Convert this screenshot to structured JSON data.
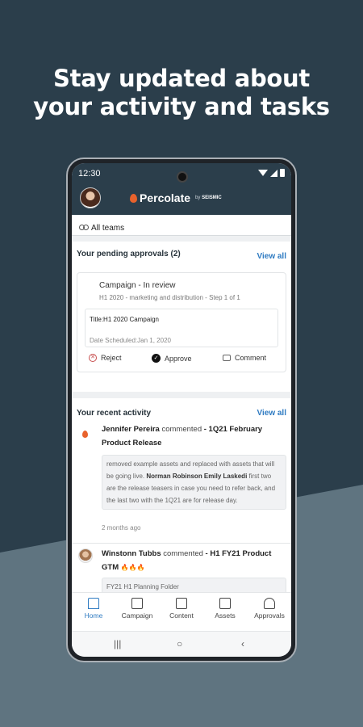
{
  "headline": {
    "line1": "Stay updated about",
    "line2": "your activity and tasks"
  },
  "status_bar": {
    "time": "12:30"
  },
  "app": {
    "logo_text": "Percolate",
    "logo_by": "by",
    "logo_brand": "SEISMIC"
  },
  "filter": {
    "label": "All teams"
  },
  "approvals": {
    "title": "Your pending approvals (2)",
    "view_all": "View all",
    "item": {
      "title": "Campaign - In review",
      "subtitle": "H1 2020 - marketing and distribution  - Step 1 of 1",
      "detail_title": "Title:H1 2020 Campaign",
      "detail_date": "Date Scheduled:Jan 1, 2020"
    },
    "actions": {
      "reject": "Reject",
      "approve": "Approve",
      "comment": "Comment"
    }
  },
  "activity": {
    "title": "Your recent activity",
    "view_all": "View all",
    "items": [
      {
        "user": "Jennifer Pereira",
        "verb": "commented",
        "target": "- 1Q21 February Product Release",
        "quote_pre": "removed example assets and replaced with assets that will be going live. ",
        "quote_mentions": "Norman Robinson Emily Laskedi",
        "quote_post": " first two are the release teasers in case you need to refer back, and the last two with the 1Q21 are for release day.",
        "time": "2 months ago"
      },
      {
        "user": "Winstonn Tubbs",
        "verb": "commented",
        "target": "- H1 FY21 Product GTM",
        "emoji": "🔥🔥🔥",
        "quote": "FY21 H1 Planning Folder"
      }
    ]
  },
  "bottom_nav": {
    "items": [
      {
        "label": "Home",
        "icon": "home-icon"
      },
      {
        "label": "Campaign",
        "icon": "calendar-icon"
      },
      {
        "label": "Content",
        "icon": "document-icon"
      },
      {
        "label": "Assets",
        "icon": "image-icon"
      },
      {
        "label": "Approvals",
        "icon": "stamp-icon"
      }
    ]
  },
  "system_nav": {
    "recents": "|||",
    "home": "○",
    "back": "‹"
  },
  "colors": {
    "background": "#2b3e4b",
    "accent": "#2f7bc2",
    "brand": "#e8622c"
  }
}
